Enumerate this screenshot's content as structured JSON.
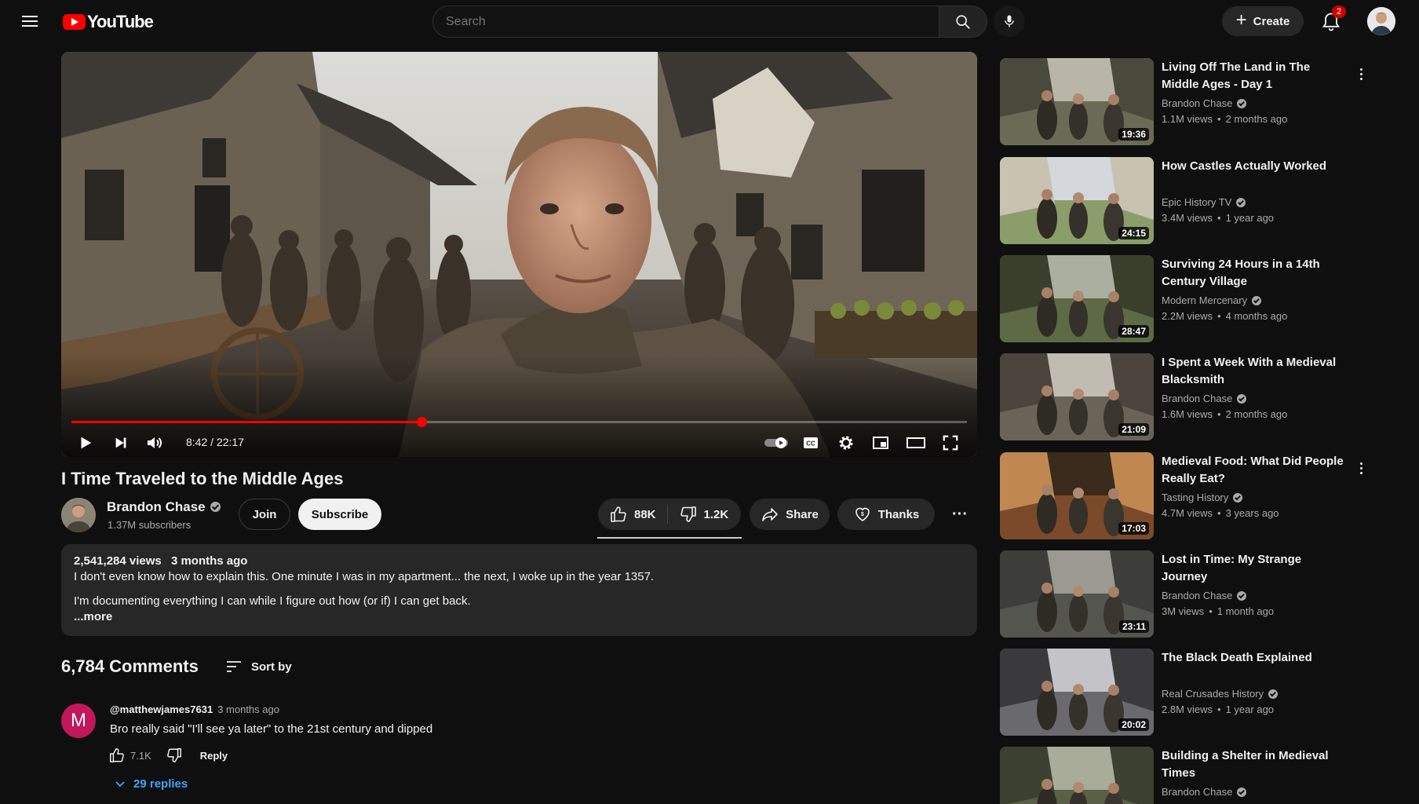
{
  "header": {
    "logo_text": "YouTube",
    "search_placeholder": "Search",
    "create_label": "Create",
    "notification_count": "2",
    "icons": [
      "menu-icon",
      "search-icon",
      "mic-icon",
      "plus-icon",
      "bell-icon"
    ]
  },
  "player": {
    "time_current": "8:42",
    "time_total": "22:17",
    "progress": 0.391,
    "icons": [
      "play-icon",
      "next-icon",
      "volume-icon",
      "autoplay-icon",
      "captions-icon",
      "settings-icon",
      "miniplayer-icon",
      "theater-icon",
      "fullscreen-icon"
    ]
  },
  "video": {
    "title": "I Time Traveled to the Middle Ages",
    "channel": "Brandon Chase",
    "subscribers": "1.37M subscribers",
    "join_label": "Join",
    "subscribe_label": "Subscribe",
    "likes": "88K",
    "dislikes": "1.2K",
    "share_label": "Share",
    "thanks_label": "Thanks",
    "more_label": "···"
  },
  "description": {
    "views": "2,541,284 views",
    "date": "3 months ago",
    "line1": "I don't even know how to explain this. One minute I was in my apartment... the next, I woke up in the year 1357.",
    "line2": "I'm documenting everything I can while I figure out how (or if) I can get back.",
    "more": "...more"
  },
  "comments": {
    "count_label": "6,784 Comments",
    "sort_label": "Sort by",
    "items": [
      {
        "avatar_letter": "M",
        "author": "@matthewjames7631",
        "when": "3 months ago",
        "text": "Bro really said \"I'll see ya later\" to the 21st century and dipped",
        "likes": "7.1K",
        "reply_label": "Reply",
        "replies_label": "29 replies"
      }
    ]
  },
  "sidebar": {
    "items": [
      {
        "title": "Living Off The Land in The Middle Ages - Day 1",
        "channel": "Brandon Chase",
        "views": "1.1M views",
        "age": "2 months ago",
        "duration": "19:36"
      },
      {
        "title": "How Castles Actually Worked",
        "channel": "Epic History TV",
        "views": "3.4M views",
        "age": "1 year ago",
        "duration": "24:15"
      },
      {
        "title": "Surviving 24 Hours in a 14th Century Village",
        "channel": "Modern Mercenary",
        "views": "2.2M views",
        "age": "4 months ago",
        "duration": "28:47"
      },
      {
        "title": "I Spent a Week With a Medieval Blacksmith",
        "channel": "Brandon Chase",
        "views": "1.6M views",
        "age": "2 months ago",
        "duration": "21:09"
      },
      {
        "title": "Medieval Food: What Did People Really Eat?",
        "channel": "Tasting History",
        "views": "4.7M views",
        "age": "3 years ago",
        "duration": "17:03"
      },
      {
        "title": "Lost in Time: My Strange Journey",
        "channel": "Brandon Chase",
        "views": "3M views",
        "age": "1 month ago",
        "duration": "23:11"
      },
      {
        "title": "The Black Death Explained",
        "channel": "Real Crusades History",
        "views": "2.8M views",
        "age": "1 year ago",
        "duration": "20:02"
      },
      {
        "title": "Building a Shelter in Medieval Times",
        "channel": "Brandon Chase",
        "views": "",
        "age": "",
        "duration": ""
      }
    ]
  }
}
